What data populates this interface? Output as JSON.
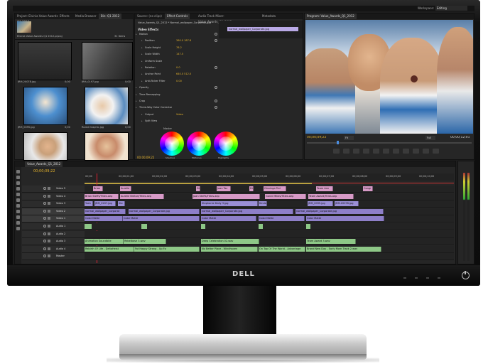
{
  "brand": "DELL",
  "app": {
    "workspace_label": "Workspace:",
    "workspace_value": "Editing",
    "project_panel": {
      "tabs": [
        "Project: Elvinia Value Awards Q1 2012",
        "Effects",
        "Media Browser",
        "Bin: Q1 2012"
      ],
      "project_name": "Elvinia Value Awards Q1 2012.prproj",
      "item_count": "31 Items",
      "items": [
        {
          "name": "JRM-20078.jpg",
          "dur": "0;00"
        },
        {
          "name": "JRM_0197.jpg",
          "dur": "0;00"
        },
        {
          "name": "JRM_0095.jpg",
          "dur": "0;00"
        },
        {
          "name": "Ruled Graphic.jpg",
          "dur": "0;00"
        },
        {
          "name": "JRM_0095.jpg",
          "dur": "0;00"
        },
        {
          "name": "Fans.jpg",
          "dur": "0;00"
        }
      ]
    },
    "effect_controls": {
      "tabs": [
        "Source: (no clips)",
        "Effect Controls",
        "Audio Track Mixer: Value_Awards_Q1_2012",
        "Metadata"
      ],
      "sequence_label": "Value_Awards_Q1_2012 * Normal_wallpaper_Corporate.jpg",
      "clip_label": "normal_wallpaper_Corporate.jpg",
      "section": "Video Effects",
      "rows": [
        {
          "name": "Motion",
          "value": ""
        },
        {
          "name": "Position",
          "value": "360.0    187.8"
        },
        {
          "name": "Scale Height",
          "value": "76.2"
        },
        {
          "name": "Scale Width",
          "value": "147.5"
        },
        {
          "name": "Uniform Scale",
          "value": ""
        },
        {
          "name": "Rotation",
          "value": "0.0"
        },
        {
          "name": "Anchor Point",
          "value": "640.0    512.0"
        },
        {
          "name": "Anti-flicker Filter",
          "value": "0.00"
        },
        {
          "name": "Opacity",
          "value": ""
        },
        {
          "name": "Time Remapping",
          "value": ""
        },
        {
          "name": "Crop",
          "value": ""
        },
        {
          "name": "Three-Way Color Corrector",
          "value": ""
        },
        {
          "name": "Output",
          "value": "Video"
        },
        {
          "name": "Split View",
          "value": ""
        }
      ],
      "wheel_title": "Master",
      "wheels": [
        "Shadows",
        "Midtones",
        "Highlights"
      ],
      "timecode": "00;00;09;22"
    },
    "program_monitor": {
      "tab": "Program: Value_Awards_Q1_2012",
      "timecode_left": "00;00;09;22",
      "fit": "Fit",
      "quality": "Full",
      "timecode_right": "00;00;12;01"
    },
    "timeline": {
      "tab": "Value_Awards_Q1_2012",
      "timecode": "00;00;09;22",
      "ruler": [
        "00;00",
        "00;00;01;00",
        "00;00;02;00",
        "00;00;03;00",
        "00;00;04;00",
        "00;00;05;00",
        "00;00;06;00",
        "00;00;07;00",
        "00;00;08;00",
        "00;00;09;00",
        "00;00;10;00"
      ],
      "tracks": [
        "Video 5",
        "Video 4",
        "Video 3",
        "Video 2",
        "Video 1",
        "Audio 1",
        "Audio 2",
        "Audio 3",
        "Audio 4",
        "Master"
      ],
      "clips": {
        "v5": [
          "Brian",
          "Aurelie",
          "Dix",
          "Joan Taz",
          "Dix",
          "Ginninga Trel",
          "Team Ann",
          "Congr"
        ],
        "v4": [
          "Brian Steffs/Titles.aep",
          "Aurelie Breton/Titles.aep",
          "Joan Steffs/Titles.aep",
          "Gonni Mikes/Titles.aep",
          "Team Award/Titles.aep"
        ],
        "v3": [
          "Yash",
          "JRM_0207.jpg",
          "Ste",
          "Stephanie Daily 3.jpg",
          "Kinde",
          "JRM_0095.jpg",
          "JRM-20078.jpg"
        ],
        "v2": [
          "normal_wallpaper_Corporat",
          "normal_wallpaper_Corporate.jpg",
          "normal_wallpaper_Corporate.jpg",
          "normal_wallpaper_Corporate.jpg"
        ],
        "v1": [
          "Color Matte",
          "Color Matte",
          "Color Matte",
          "Color Matte",
          "Color Matte"
        ],
        "a3": [
          "Animation Soundbite",
          "Rebelbase 3.wav",
          "Deep Celebration 02.wav",
          "Team Award 3.wav"
        ],
        "a4": [
          "Rebirth Of Life - DeltaHeist",
          "Fat Happy Strang - Up Fo",
          "No Better Place - Windhaven",
          "On Top Of The World - Advantage",
          "Brand New Day - Early Morn Track 2.wav"
        ]
      }
    }
  },
  "colors": {
    "panel": "#262626",
    "accent": "#e4c04a",
    "pink_clip": "#d79ac7",
    "purple_clip": "#9b8fd6",
    "violet_clip": "#8e7fc8",
    "green_clip": "#8ec887",
    "timecode": "#e4b22c"
  }
}
